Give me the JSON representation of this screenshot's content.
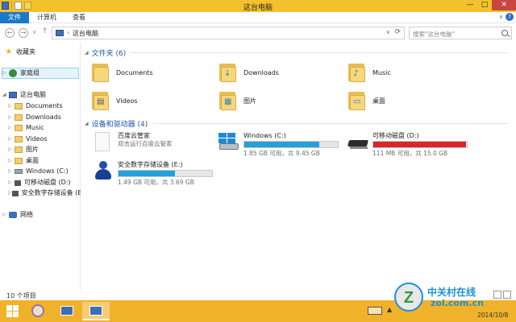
{
  "window": {
    "title": "这台电脑",
    "ribbon_tabs": [
      "文件",
      "计算机",
      "查看"
    ],
    "ribbon_toggle": "∨",
    "help": "?",
    "controls": {
      "minimize": "—",
      "maximize": "□",
      "close": "✕"
    }
  },
  "address": {
    "back": "←",
    "forward": "→",
    "history": "∨",
    "up": "↑",
    "separator": "›",
    "path": "这台电脑",
    "dropdown": "∨",
    "refresh": "⟳",
    "search_placeholder": "搜索\"这台电脑\""
  },
  "nav": {
    "favorites": "收藏夹",
    "homegroup": "家庭组",
    "this_pc": "这台电脑",
    "items": [
      {
        "label": "Documents",
        "icon": "folder-icon"
      },
      {
        "label": "Downloads",
        "icon": "folder-icon"
      },
      {
        "label": "Music",
        "icon": "folder-icon"
      },
      {
        "label": "Videos",
        "icon": "folder-icon"
      },
      {
        "label": "图片",
        "icon": "folder-icon"
      },
      {
        "label": "桌面",
        "icon": "folder-icon"
      },
      {
        "label": "Windows (C:)",
        "icon": "drive-icon"
      },
      {
        "label": "可移动磁盘 (D:)",
        "icon": "usb-drive-icon"
      },
      {
        "label": "安全数字存储设备 (E",
        "icon": "sd-card-icon"
      }
    ],
    "network": "网络"
  },
  "content": {
    "folders_header": "文件夹 (6)",
    "folders": [
      {
        "label": "Documents",
        "glyph": ""
      },
      {
        "label": "Downloads",
        "glyph": "↓"
      },
      {
        "label": "Music",
        "glyph": "♪"
      },
      {
        "label": "Videos",
        "glyph": "▤"
      },
      {
        "label": "图片",
        "glyph": "▦"
      },
      {
        "label": "桌面",
        "glyph": "▭"
      }
    ],
    "drives_header": "设备和驱动器 (4)",
    "drives": [
      {
        "name": "百度云管家",
        "subtitle": "双击运行百度云管家",
        "has_bar": false
      },
      {
        "name": "Windows (C:)",
        "subtitle": "1.85 GB 可用，共 9.45 GB",
        "has_bar": true,
        "used_fraction": 0.8,
        "bar_color": "#26a0da"
      },
      {
        "name": "可移动磁盘 (D:)",
        "subtitle": "111 MB 可用，共 15.0 GB",
        "has_bar": true,
        "used_fraction": 0.99,
        "bar_color": "#da2626"
      },
      {
        "name": "安全数字存储设备 (E:)",
        "subtitle": "1.49 GB 可用，共 3.69 GB",
        "has_bar": true,
        "used_fraction": 0.6,
        "bar_color": "#26a0da"
      }
    ]
  },
  "status": {
    "item_count": "10 个项目"
  },
  "taskbar": {
    "tray_arrow": "▲",
    "date": "2014/10/8"
  },
  "watermark": {
    "text1": "中关村在线",
    "text2": "zol.com.cn"
  },
  "colors": {
    "accent": "#1979ca",
    "titlebar": "#f4c12c",
    "taskbar": "#f0b22a",
    "group_header": "#1e5aa8"
  }
}
